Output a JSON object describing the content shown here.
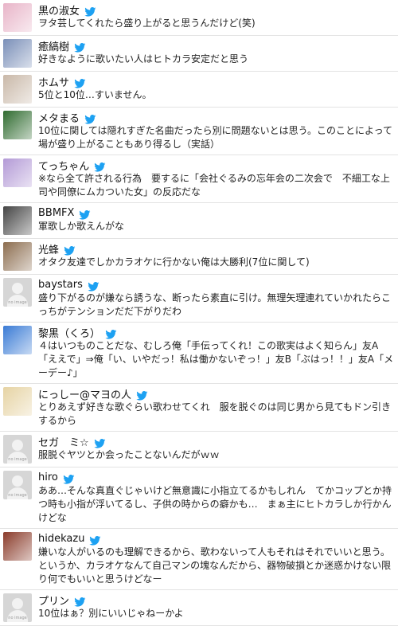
{
  "tweets": [
    {
      "name": "黒の淑女",
      "text": "ヲタ芸してくれたら盛り上がると思うんだけど(笑)",
      "avatar": "anime-girl-avatar",
      "avatar_color": "#e8b4c8",
      "noimage": false
    },
    {
      "name": "癒縞樹",
      "text": "好きなように歌いたい人はヒトカラ安定だと思う",
      "avatar": "anime-character-avatar",
      "avatar_color": "#7a8fb8",
      "noimage": false
    },
    {
      "name": "ホムサ",
      "text": "5位と10位…すいません。",
      "avatar": "character-avatar",
      "avatar_color": "#c9b8a8",
      "noimage": false
    },
    {
      "name": "メタまる",
      "text": "10位に関しては隠れすぎた名曲だったら別に問題ないとは思う。このことによって場が盛り上がることもあり得るし（実話）",
      "avatar": "green-sphere-avatar",
      "avatar_color": "#2f6b2f",
      "noimage": false
    },
    {
      "name": "てっちゃん",
      "text": "※なら全て許される行為　要するに「会社ぐるみの忘年会の二次会で　不細工な上司や同僚にムカついた女」の反応だな",
      "avatar": "anime-avatar",
      "avatar_color": "#b39ad6",
      "noimage": false
    },
    {
      "name": "BBMFX",
      "text": "軍歌しか歌えんがな",
      "avatar": "dark-photo-avatar",
      "avatar_color": "#444444",
      "noimage": false
    },
    {
      "name": "光蜂",
      "text": "オタク友達でしかカラオケに行かない俺は大勝利(7位に関して)",
      "avatar": "clock-avatar",
      "avatar_color": "#8c6d4f",
      "noimage": false
    },
    {
      "name": "baystars",
      "text": "盛り下がるのが嫌なら誘うな、断ったら素直に引け。無理矢理連れていかれたらこっちがテンションだだ下がりだわ",
      "avatar": "no-image-avatar",
      "avatar_color": "#d6d6d6",
      "noimage": true
    },
    {
      "name": "黎黒（くろ）",
      "text": "４はいつものことだな、むしろ俺「手伝ってくれ！この歌実はよく知らん」友A「ええで」⇒俺「い、いやだっ！私は働かないぞっ！」友B「ぶはっ！！」友A「メーデー♪」",
      "avatar": "colorful-character-avatar",
      "avatar_color": "#3a7bd5",
      "noimage": false
    },
    {
      "name": "にっしー@マヨの人",
      "text": "とりあえず好きな歌ぐらい歌わせてくれ　服を脱ぐのは同じ男から見てもドン引きするから",
      "avatar": "anime-girl-avatar",
      "avatar_color": "#e6d3a3",
      "noimage": false
    },
    {
      "name": "セガ　ミ☆",
      "text": "服脱ぐヤツとか会ったことないんだがｗｗ",
      "avatar": "no-image-avatar",
      "avatar_color": "#d6d6d6",
      "noimage": true
    },
    {
      "name": "hiro",
      "text": "ああ…そんな真直ぐじゃいけど無意識に小指立てるかもしれん　てかコップとか持つ時も小指が浮いてるし、子供の時からの癖かも…　まぁ主にヒトカラしか行かんけどな",
      "avatar": "no-image-avatar",
      "avatar_color": "#d6d6d6",
      "noimage": true
    },
    {
      "name": "hidekazu",
      "text": "嫌いな人がいるのも理解できるから、歌わないって人もそれはそれでいいと思う。というか、カラオケなんて自己マンの塊なんだから、器物破損とか迷惑かけない限り何でもいいと思うけどなー",
      "avatar": "warrior-avatar",
      "avatar_color": "#8a3b2a",
      "noimage": false
    },
    {
      "name": "プリン",
      "text": "10位はぁ？別にいいじゃねーかよ",
      "avatar": "no-image-avatar",
      "avatar_color": "#d6d6d6",
      "noimage": true
    }
  ],
  "labels": {
    "no_image": "no image"
  },
  "colors": {
    "twitter_blue": "#1da1f2",
    "divider": "#e3e3e3"
  },
  "icons": {
    "verified": "twitter-bird-icon"
  }
}
